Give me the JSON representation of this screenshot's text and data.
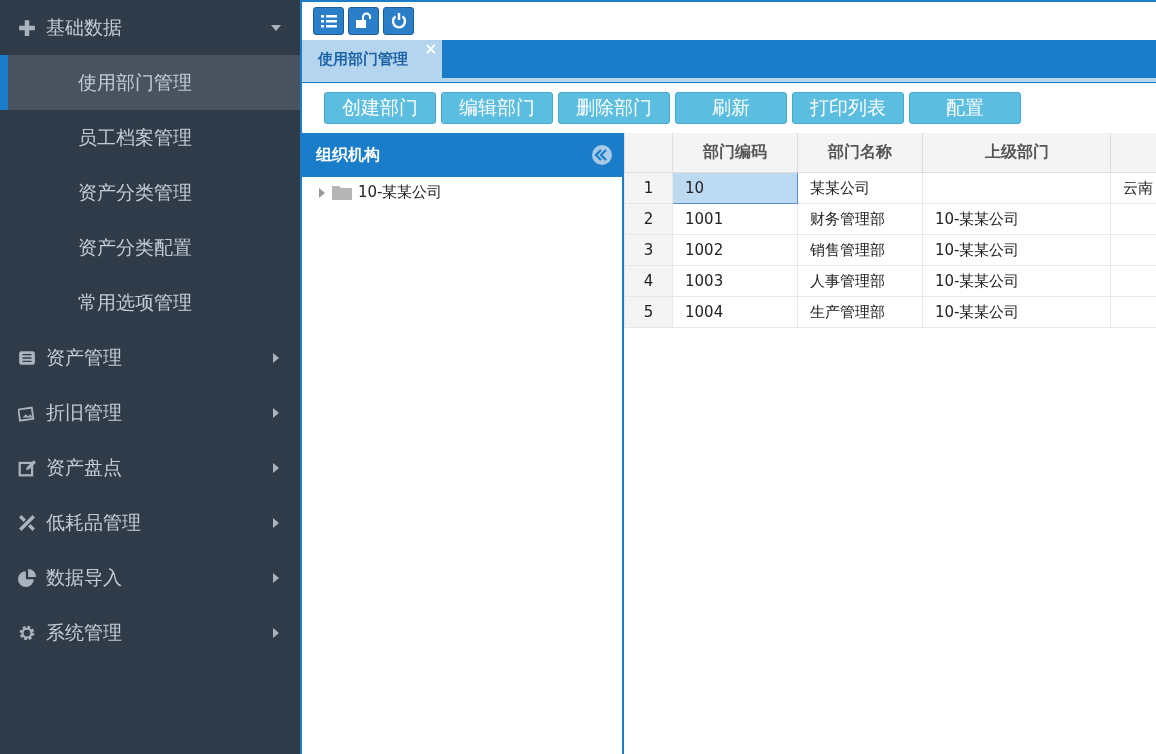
{
  "sidebar": {
    "groups": [
      {
        "label": "基础数据",
        "expanded": true,
        "children": [
          {
            "label": "使用部门管理",
            "selected": true
          },
          {
            "label": "员工档案管理",
            "selected": false
          },
          {
            "label": "资产分类管理",
            "selected": false
          },
          {
            "label": "资产分类配置",
            "selected": false
          },
          {
            "label": "常用选项管理",
            "selected": false
          }
        ]
      },
      {
        "label": "资产管理",
        "expanded": false
      },
      {
        "label": "折旧管理",
        "expanded": false
      },
      {
        "label": "资产盘点",
        "expanded": false
      },
      {
        "label": "低耗品管理",
        "expanded": false
      },
      {
        "label": "数据导入",
        "expanded": false
      },
      {
        "label": "系统管理",
        "expanded": false
      }
    ]
  },
  "tabs": [
    {
      "label": "使用部门管理",
      "selected": true,
      "close": "×"
    }
  ],
  "actions": [
    "创建部门",
    "编辑部门",
    "删除部门",
    "刷新",
    "打印列表",
    "配置"
  ],
  "tree": {
    "title": "组织机构",
    "nodes": [
      {
        "label": "10-某某公司",
        "expanded": false
      }
    ]
  },
  "table": {
    "columns": [
      "部门编码",
      "部门名称",
      "上级部门"
    ],
    "rows": [
      {
        "num": "1",
        "code": "10",
        "name": "某某公司",
        "column_5": "云南",
        "selected": true
      },
      {
        "num": "2",
        "code": "1001",
        "name": "财务管理部",
        "parent": "10-某某公司",
        "selected": false
      },
      {
        "num": "3",
        "code": "1002",
        "name": "销售管理部",
        "parent": "10-某某公司",
        "selected": false
      },
      {
        "num": "4",
        "code": "1003",
        "name": "人事管理部",
        "parent": "10-某某公司",
        "selected": false
      },
      {
        "num": "5",
        "code": "1004",
        "name": "生产管理部",
        "parent": "10-某某公司",
        "selected": false
      }
    ]
  }
}
